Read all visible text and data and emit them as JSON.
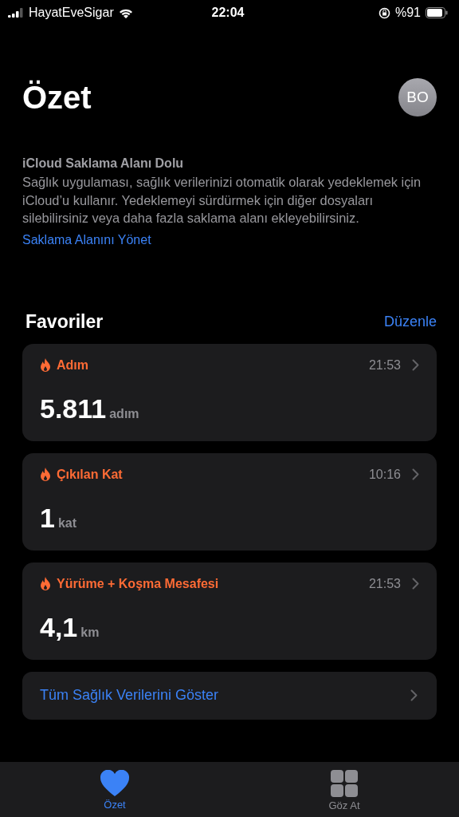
{
  "status_bar": {
    "carrier": "HayatEveSigar",
    "time": "22:04",
    "battery": "%91"
  },
  "header": {
    "title": "Özet",
    "avatar": "BO"
  },
  "notice": {
    "title": "iCloud Saklama Alanı Dolu",
    "body": "Sağlık uygulaması, sağlık verilerinizi otomatik olarak yedeklemek için iCloud’u kullanır. Yedeklemeyi sürdürmek için diğer dosyaları silebilirsiniz veya daha fazla saklama alanı ekleyebilirsiniz.",
    "link": "Saklama Alanını Yönet"
  },
  "favorites": {
    "title": "Favoriler",
    "edit": "Düzenle",
    "cards": [
      {
        "label": "Adım",
        "time": "21:53",
        "value": "5.811",
        "unit": "adım"
      },
      {
        "label": "Çıkılan Kat",
        "time": "10:16",
        "value": "1",
        "unit": "kat"
      },
      {
        "label": "Yürüme + Koşma Mesafesi",
        "time": "21:53",
        "value": "4,1",
        "unit": "km"
      }
    ],
    "show_all": "Tüm Sağlık Verilerini Göster"
  },
  "tab_bar": [
    {
      "label": "Özet",
      "kind": "heart",
      "selected": true
    },
    {
      "label": "Göz At",
      "kind": "grid",
      "selected": false
    }
  ]
}
